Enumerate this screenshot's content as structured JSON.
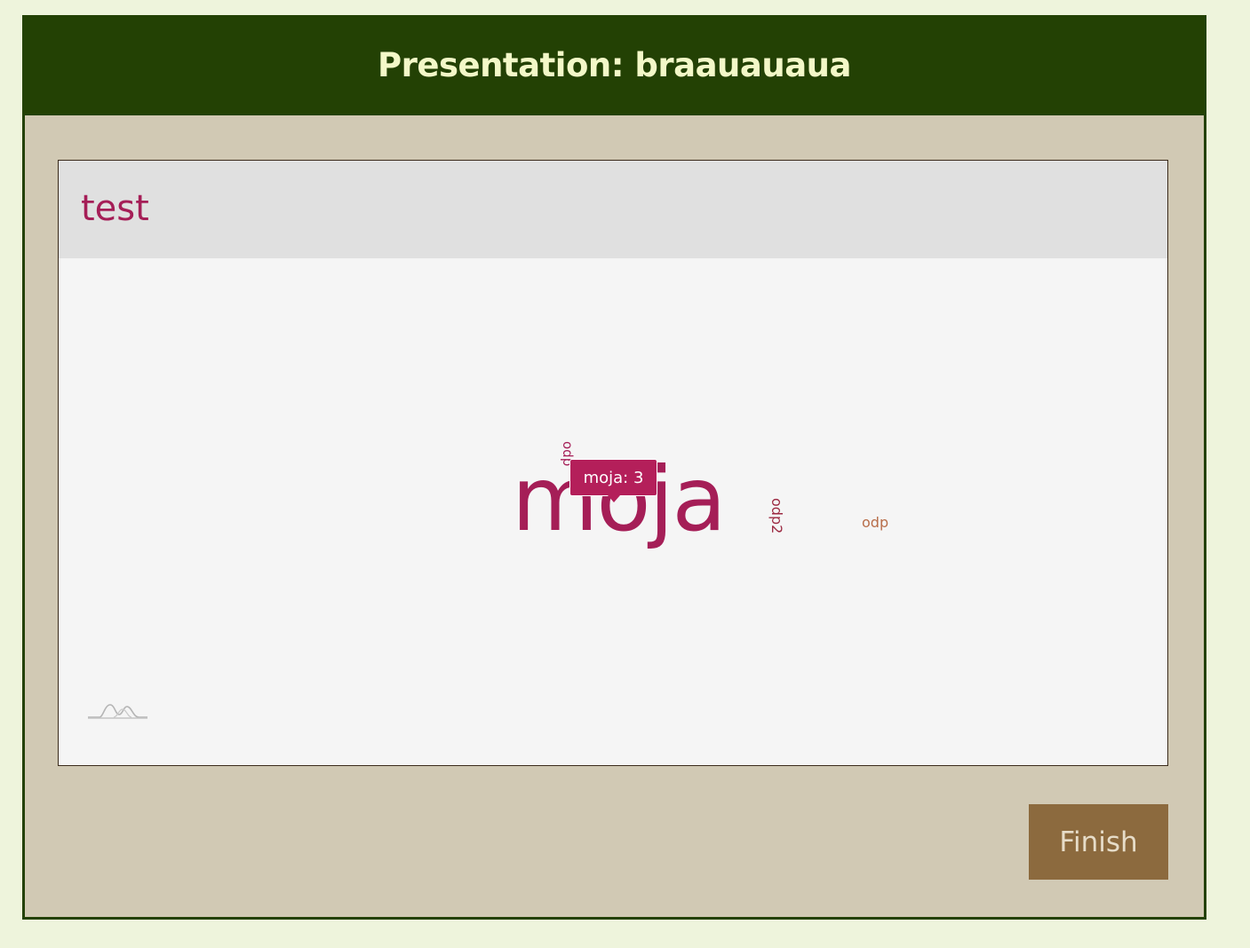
{
  "header": {
    "title": "Presentation: braauauaua"
  },
  "question": {
    "title": "test"
  },
  "word_cloud": {
    "words": [
      {
        "text": "moja",
        "count": 3,
        "color": "#a51e57"
      },
      {
        "text": "odp2",
        "color": "#9c2a42"
      },
      {
        "text": "odp",
        "color": "#b86e4a"
      },
      {
        "text": "odp",
        "color": "#a51e57"
      }
    ],
    "tooltip": "moja: 3"
  },
  "footer": {
    "finish_label": "Finish"
  },
  "colors": {
    "header_bg": "#234104",
    "panel_bg": "#d1c9b4",
    "accent": "#a51e57",
    "button_bg": "#8c6a3e"
  }
}
